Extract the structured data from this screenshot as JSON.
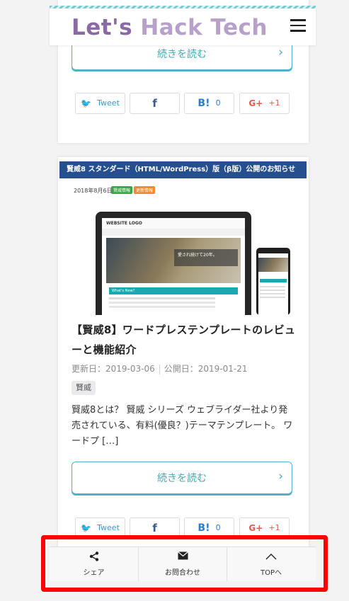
{
  "header": {
    "logo_part1": "Let's",
    "logo_part2": "Hack Tech",
    "menu_icon": "hamburger-menu-icon"
  },
  "top_card": {
    "read_more_label": "続きを読む",
    "share": {
      "twitter_label": "Tweet",
      "facebook_label": "f",
      "hatena_label": "B!",
      "hatena_count": "0",
      "gplus_label": "G+",
      "gplus_count": "+1"
    }
  },
  "article": {
    "thumbnail": {
      "banner_text": "賢威8 スタンダード（HTML/WordPress）版（β版）公開のお知らせ",
      "date_text": "2018年8月6日",
      "tag1": "賢威情報",
      "tag2": "更新情報",
      "mock_logo": "WEBSITE LOGO",
      "mock_hero_text": "愛され続けて20年。",
      "mock_section": "What's New?"
    },
    "title": "【賢威8】ワードプレステンプレートのレビューと機能紹介",
    "updated": "更新日：2019-03-06",
    "published": "公開日：2019-01-21",
    "category": "賢威",
    "excerpt": "賢威8とは？ 賢威 シリーズ ウェブライダー社より発売されている、有料(優良？)テーマテンプレート。 ワードプ […]",
    "read_more_label": "続きを読む",
    "share": {
      "twitter_label": "Tweet",
      "facebook_label": "f",
      "hatena_label": "B!",
      "hatena_count": "0",
      "gplus_label": "G+",
      "gplus_count": "+1"
    }
  },
  "bottom_bar": {
    "share_label": "シェア",
    "contact_label": "お問合わせ",
    "top_label": "TOPへ"
  },
  "colors": {
    "accent": "#4fb3c3",
    "logo_dark": "#8a6aa5",
    "logo_light": "#b7a0c9",
    "highlight": "#ff0000"
  }
}
